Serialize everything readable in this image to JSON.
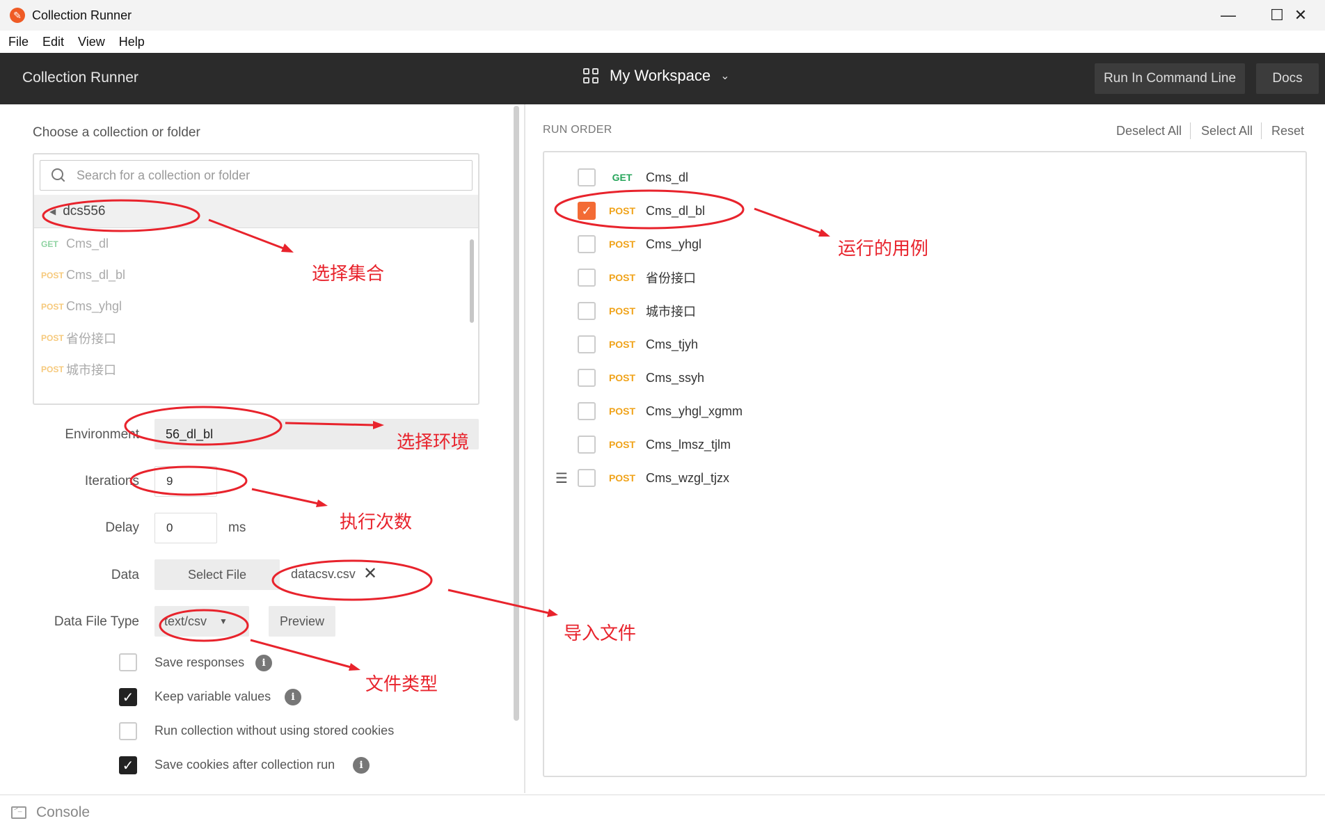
{
  "window": {
    "title": "Collection Runner",
    "controls": {
      "minimize": "—",
      "maximize": "☐",
      "close": "✕"
    }
  },
  "menu": [
    "File",
    "Edit",
    "View",
    "Help"
  ],
  "header": {
    "title": "Collection Runner",
    "workspace": "My Workspace",
    "run_cli_label": "Run In Command Line",
    "docs_label": "Docs"
  },
  "left": {
    "choose_label": "Choose a collection or folder",
    "search_placeholder": "Search for a collection or folder",
    "collection_name": "dcs556",
    "requests": [
      {
        "method": "GET",
        "name": "Cms_dl"
      },
      {
        "method": "POST",
        "name": "Cms_dl_bl"
      },
      {
        "method": "POST",
        "name": "Cms_yhgl"
      },
      {
        "method": "POST",
        "name": "省份接口"
      },
      {
        "method": "POST",
        "name": "城市接口"
      }
    ],
    "environment_label": "Environment",
    "environment_value": "56_dl_bl",
    "iterations_label": "Iterations",
    "iterations_value": "9",
    "delay_label": "Delay",
    "delay_value": "0",
    "delay_unit": "ms",
    "data_label": "Data",
    "select_file_label": "Select File",
    "file_name": "datacsv.csv",
    "data_file_type_label": "Data File Type",
    "data_file_type_value": "text/csv",
    "preview_label": "Preview",
    "options": [
      {
        "label": "Save responses",
        "checked": false,
        "info": true
      },
      {
        "label": "Keep variable values",
        "checked": true,
        "info": true
      },
      {
        "label": "Run collection without using stored cookies",
        "checked": false,
        "info": false
      },
      {
        "label": "Save cookies after collection run",
        "checked": true,
        "info": true
      }
    ]
  },
  "right": {
    "run_order_label": "RUN ORDER",
    "deselect_all": "Deselect All",
    "select_all": "Select All",
    "reset": "Reset",
    "requests": [
      {
        "method": "GET",
        "name": "Cms_dl",
        "checked": false
      },
      {
        "method": "POST",
        "name": "Cms_dl_bl",
        "checked": true
      },
      {
        "method": "POST",
        "name": "Cms_yhgl",
        "checked": false
      },
      {
        "method": "POST",
        "name": "省份接口",
        "checked": false
      },
      {
        "method": "POST",
        "name": "城市接口",
        "checked": false
      },
      {
        "method": "POST",
        "name": "Cms_tjyh",
        "checked": false
      },
      {
        "method": "POST",
        "name": "Cms_ssyh",
        "checked": false
      },
      {
        "method": "POST",
        "name": "Cms_yhgl_xgmm",
        "checked": false
      },
      {
        "method": "POST",
        "name": "Cms_lmsz_tjlm",
        "checked": false
      },
      {
        "method": "POST",
        "name": "Cms_wzgl_tjzx",
        "checked": false
      }
    ]
  },
  "console_label": "Console",
  "annotations": {
    "select_collection": "选择集合",
    "select_env": "选择环境",
    "iterations_count": "执行次数",
    "import_file": "导入文件",
    "file_type": "文件类型",
    "run_cases": "运行的用例"
  },
  "colors": {
    "annotation": "#e8232c",
    "post": "#f0a31a",
    "get": "#26a55a",
    "checkbox_on": "#f36b35"
  }
}
